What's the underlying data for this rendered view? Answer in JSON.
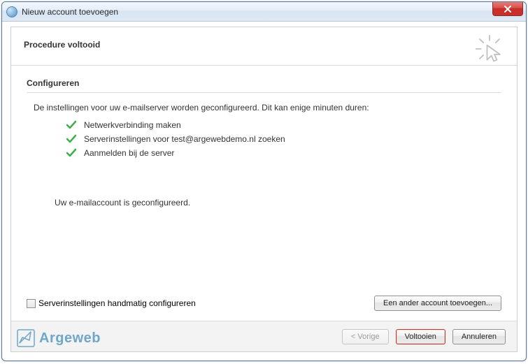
{
  "window": {
    "title": "Nieuw account toevoegen"
  },
  "header": {
    "title": "Procedure voltooid"
  },
  "config": {
    "section_title": "Configureren",
    "intro": "De instellingen voor uw e-mailserver worden geconfigureerd. Dit kan enige minuten duren:",
    "steps": [
      "Netwerkverbinding maken",
      "Serverinstellingen voor test@argewebdemo.nl zoeken",
      "Aanmelden bij de server"
    ],
    "done": "Uw e-mailaccount is geconfigureerd."
  },
  "options": {
    "manual_label": "Serverinstellingen handmatig configureren",
    "add_another": "Een ander account toevoegen..."
  },
  "buttons": {
    "back": "< Vorige",
    "finish": "Voltooien",
    "cancel": "Annuleren"
  },
  "brand": {
    "name": "Argeweb"
  }
}
